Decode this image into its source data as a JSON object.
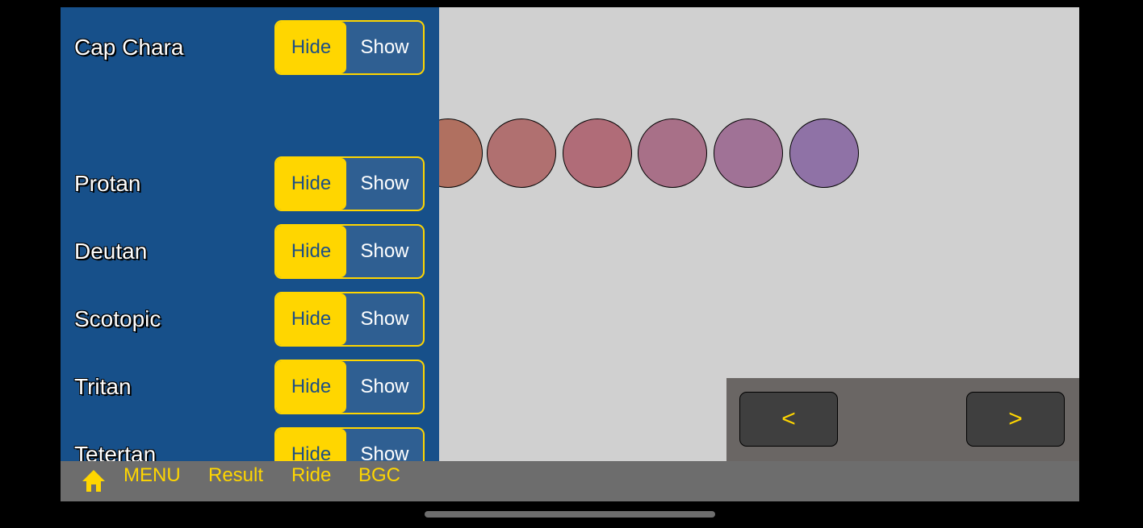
{
  "filters": [
    {
      "label": "Cap Chara",
      "hide_label": "Hide",
      "show_label": "Show"
    },
    {
      "label": "Protan",
      "hide_label": "Hide",
      "show_label": "Show"
    },
    {
      "label": "Deutan",
      "hide_label": "Hide",
      "show_label": "Show"
    },
    {
      "label": "Scotopic",
      "hide_label": "Hide",
      "show_label": "Show"
    },
    {
      "label": "Tritan",
      "hide_label": "Hide",
      "show_label": "Show"
    },
    {
      "label": "Tetertan",
      "hide_label": "Hide",
      "show_label": "Show"
    }
  ],
  "selected_option": "Hide",
  "caps": [
    {
      "color": "#b07060"
    },
    {
      "color": "#b07070"
    },
    {
      "color": "#b06c78"
    },
    {
      "color": "#a87088"
    },
    {
      "color": "#a07296"
    },
    {
      "color": "#8f72a6"
    }
  ],
  "nav": {
    "prev_label": "<",
    "next_label": ">"
  },
  "bottom_bar": {
    "home_icon": "home-icon",
    "tabs": [
      "MENU",
      "Result",
      "Ride",
      "BGC"
    ]
  },
  "colors": {
    "panel_bg": "#17508a",
    "accent": "#ffd600",
    "canvas_bg": "#d0d0d0",
    "bar_bg": "#6d6d6d"
  }
}
